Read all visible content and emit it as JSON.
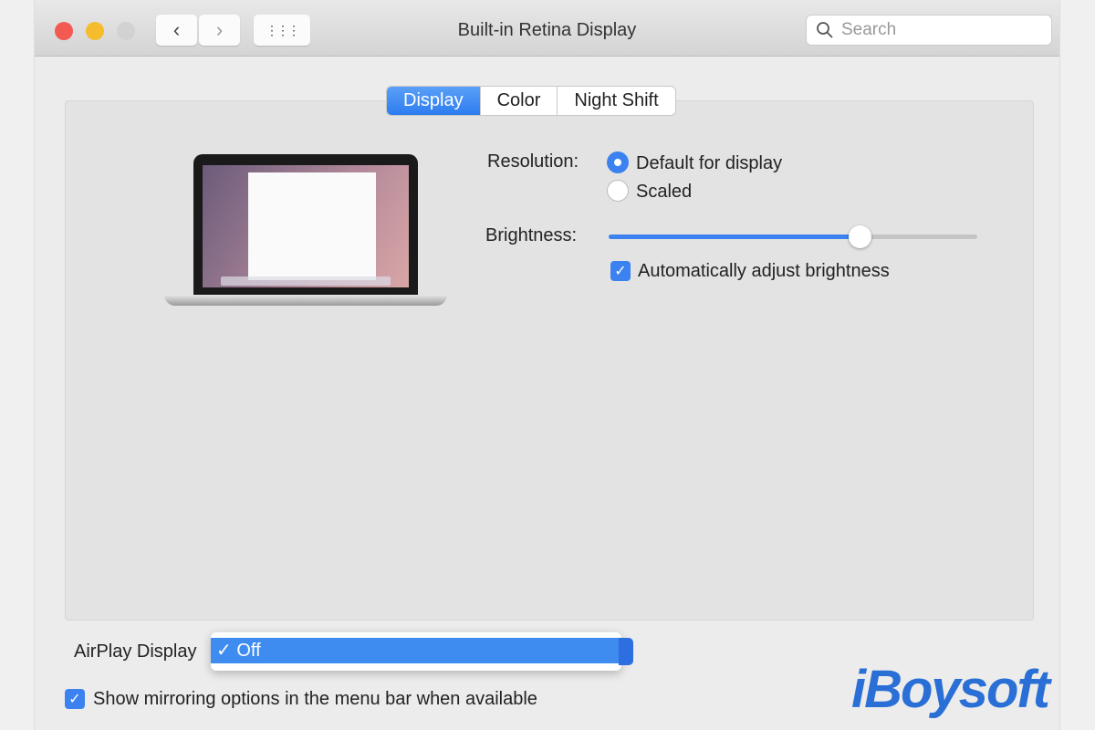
{
  "window": {
    "title": "Built-in Retina Display",
    "search_placeholder": "Search"
  },
  "toolbar": {
    "back": "‹",
    "forward": "›",
    "grid": "⋮⋮⋮"
  },
  "tabs": [
    {
      "label": "Display",
      "active": true
    },
    {
      "label": "Color",
      "active": false
    },
    {
      "label": "Night Shift",
      "active": false
    }
  ],
  "resolution": {
    "label": "Resolution:",
    "options": [
      {
        "label": "Default for display",
        "selected": true
      },
      {
        "label": "Scaled",
        "selected": false
      }
    ]
  },
  "brightness": {
    "label": "Brightness:",
    "value": 0.68,
    "auto_label": "Automatically adjust brightness",
    "auto_checked": true
  },
  "airplay": {
    "label": "AirPlay Display",
    "selected": "✓ Off"
  },
  "mirroring": {
    "label": "Show mirroring options in the menu bar when available",
    "checked": true
  },
  "watermark": "iBoysoft",
  "colors": {
    "accent": "#3b82f0",
    "close": "#f25a52",
    "minimize": "#f5bd2e"
  }
}
